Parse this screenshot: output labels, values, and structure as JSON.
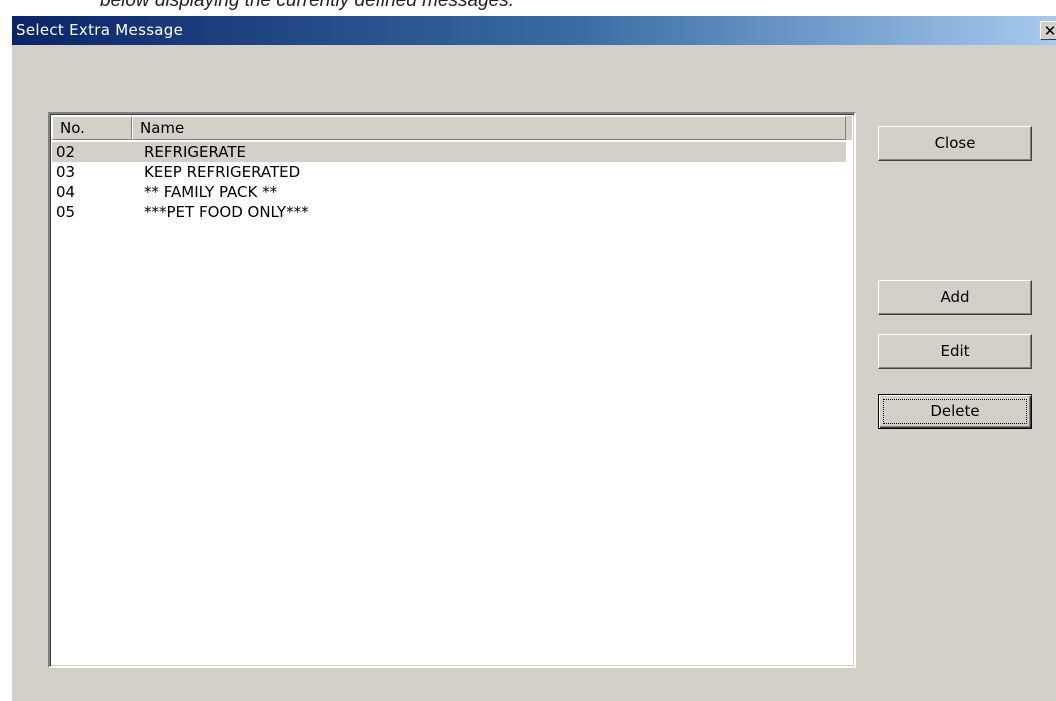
{
  "doc_caption": "below displaying the currently defined messages.",
  "window": {
    "title": "Select Extra Message",
    "close_glyph": "✕",
    "close_icon": "close-icon"
  },
  "list": {
    "columns": [
      "No.",
      "Name"
    ],
    "rows": [
      {
        "no": "02",
        "name": "REFRIGERATE",
        "selected": true
      },
      {
        "no": "03",
        "name": "KEEP REFRIGERATED",
        "selected": false
      },
      {
        "no": "04",
        "name": "** FAMILY PACK **",
        "selected": false
      },
      {
        "no": "05",
        "name": "***PET FOOD ONLY***",
        "selected": false
      }
    ]
  },
  "buttons": {
    "close": "Close",
    "add": "Add",
    "edit": "Edit",
    "delete": "Delete"
  },
  "colors": {
    "dialog_face": "#d4d0c8",
    "title_gradient_start": "#0a246a",
    "title_gradient_end": "#a6caf0",
    "title_text": "#ffffff"
  }
}
